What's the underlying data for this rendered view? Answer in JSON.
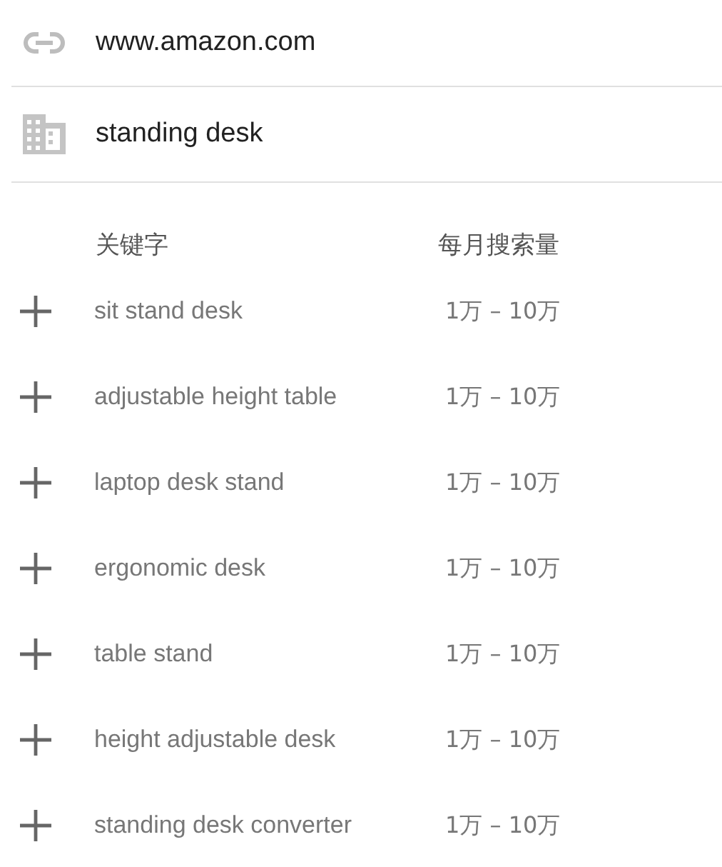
{
  "website_field": {
    "value": "www.amazon.com"
  },
  "product_field": {
    "value": "standing desk"
  },
  "table": {
    "columns": [
      "关键字",
      "每月搜索量"
    ],
    "rows": [
      {
        "keyword": "sit stand desk",
        "volume": "1万 – 10万"
      },
      {
        "keyword": "adjustable height table",
        "volume": "1万 – 10万"
      },
      {
        "keyword": "laptop desk stand",
        "volume": "1万 – 10万"
      },
      {
        "keyword": "ergonomic desk",
        "volume": "1万 – 10万"
      },
      {
        "keyword": "table stand",
        "volume": "1万 – 10万"
      },
      {
        "keyword": "height adjustable desk",
        "volume": "1万 – 10万"
      },
      {
        "keyword": "standing desk converter",
        "volume": "1万 – 10万"
      }
    ]
  }
}
